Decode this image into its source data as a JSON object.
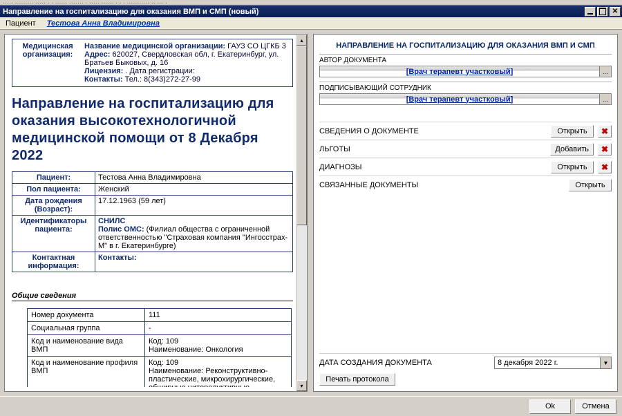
{
  "window": {
    "title": "Направление на госпитализацию для оказания ВМП и СМП (новый)",
    "menustrip_placeholder": "····· ········· ····· ·   · ······ ······· · ····· ······ · · · ··········· ·· ··· ·"
  },
  "patient_bar": {
    "label": "Пациент",
    "name": "Тестова Анна Владимировна"
  },
  "org": {
    "caption": "Медицинская организация:",
    "name_label": "Название медицинской организации:",
    "name_value": "ГАУЗ СО ЦГКБ 3",
    "addr_label": "Адрес:",
    "addr_value": "620027, Свердловская обл, г. Екатеринбург, ул. Братьев Быковых, д. 16",
    "lic_label": "Лицензия:",
    "lic_value": ". Дата регистрации:",
    "cont_label": "Контакты:",
    "cont_value": "Тел.: 8(343)272-27-99"
  },
  "doc_title": "Направление на госпитализацию для оказания высокотехнологичной медицинской помощи от 8 Декабря 2022",
  "patient_table": {
    "r1_l": "Пациент:",
    "r1_v": "Тестова Анна Владимировна",
    "r2_l": "Пол пациента:",
    "r2_v": "Женский",
    "r3_l": "Дата рождения (Возраст):",
    "r3_v": "17.12.1963 (59 лет)",
    "r4_l": "Идентификаторы пациента:",
    "r4_snils_l": "СНИЛС",
    "r4_snils_v": "",
    "r4_polis_l": "Полис ОМС:",
    "r4_polis_v": "(Филиал общества с ограниченной ответственностью \"Страховая компания \"Ингосстрах-М\" в г. Екатеринбурге)",
    "r5_l": "Контактная информация:",
    "r5_v": "Контакты:"
  },
  "general": {
    "header": "Общие сведения",
    "r1_l": "Номер документа",
    "r1_v": "111",
    "r2_l": "Социальная группа",
    "r2_v": "-",
    "r3_l": "Код и наименование вида ВМП",
    "r3_v1": "Код: 109",
    "r3_v2": "Наименование: Онкология",
    "r4_l": "Код и наименование профиля ВМП",
    "r4_v1": "Код: 109",
    "r4_v2": "Наименование: Реконструктивно-пластические, микрохирургические, обширные циторедуктивные, расширенно-"
  },
  "right": {
    "title": "НАПРАВЛЕНИЕ НА ГОСПИТАЛИЗАЦИЮ ДЛЯ ОКАЗАНИЯ ВМП И СМП",
    "author_caption": "АВТОР ДОКУМЕНТА",
    "author_value": "[Врач терапевт участковый]",
    "signer_caption": "ПОДПИСЫВАЮЩИЙ СОТРУДНИК",
    "signer_value": "[Врач терапевт участковый]",
    "rows": [
      {
        "label": "СВЕДЕНИЯ О ДОКУМЕНТЕ",
        "btn": "Открыть"
      },
      {
        "label": "ЛЬГОТЫ",
        "btn": "Добавить"
      },
      {
        "label": "ДИАГНОЗЫ",
        "btn": "Открыть"
      },
      {
        "label": "СВЯЗАННЫЕ ДОКУМЕНТЫ",
        "btn": "Открыть"
      }
    ],
    "date_caption": "ДАТА СОЗДАНИЯ ДОКУМЕНТА",
    "date_value": "8 декабря 2022 г.",
    "print_btn": "Печать протокола"
  },
  "footer": {
    "ok": "Ok",
    "cancel": "Отмена"
  }
}
